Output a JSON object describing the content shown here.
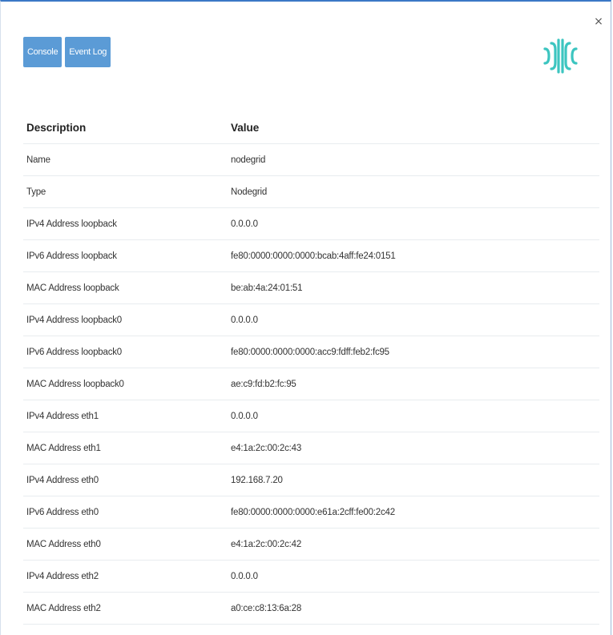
{
  "dialog": {
    "close_label": "×"
  },
  "toolbar": {
    "console_label": "Console",
    "event_log_label": "Event Log"
  },
  "brand": {
    "logo_icon": "zpe-logo-icon",
    "accent_color": "#3cc5c0"
  },
  "colors": {
    "button_bg": "#5b9bd6",
    "top_border": "#3b78c6"
  },
  "table": {
    "header_description": "Description",
    "header_value": "Value",
    "rows": [
      {
        "description": "Name",
        "value": "nodegrid"
      },
      {
        "description": "Type",
        "value": "Nodegrid"
      },
      {
        "description": "IPv4 Address loopback",
        "value": "0.0.0.0"
      },
      {
        "description": "IPv6 Address loopback",
        "value": "fe80:0000:0000:0000:bcab:4aff:fe24:0151"
      },
      {
        "description": "MAC Address loopback",
        "value": "be:ab:4a:24:01:51"
      },
      {
        "description": "IPv4 Address loopback0",
        "value": "0.0.0.0"
      },
      {
        "description": "IPv6 Address loopback0",
        "value": "fe80:0000:0000:0000:acc9:fdff:feb2:fc95"
      },
      {
        "description": "MAC Address loopback0",
        "value": "ae:c9:fd:b2:fc:95"
      },
      {
        "description": "IPv4 Address eth1",
        "value": "0.0.0.0"
      },
      {
        "description": "MAC Address eth1",
        "value": "e4:1a:2c:00:2c:43"
      },
      {
        "description": "IPv4 Address eth0",
        "value": "192.168.7.20"
      },
      {
        "description": "IPv6 Address eth0",
        "value": "fe80:0000:0000:0000:e61a:2cff:fe00:2c42"
      },
      {
        "description": "MAC Address eth0",
        "value": "e4:1a:2c:00:2c:42"
      },
      {
        "description": "IPv4 Address eth2",
        "value": "0.0.0.0"
      },
      {
        "description": "MAC Address eth2",
        "value": "a0:ce:c8:13:6a:28"
      }
    ]
  }
}
